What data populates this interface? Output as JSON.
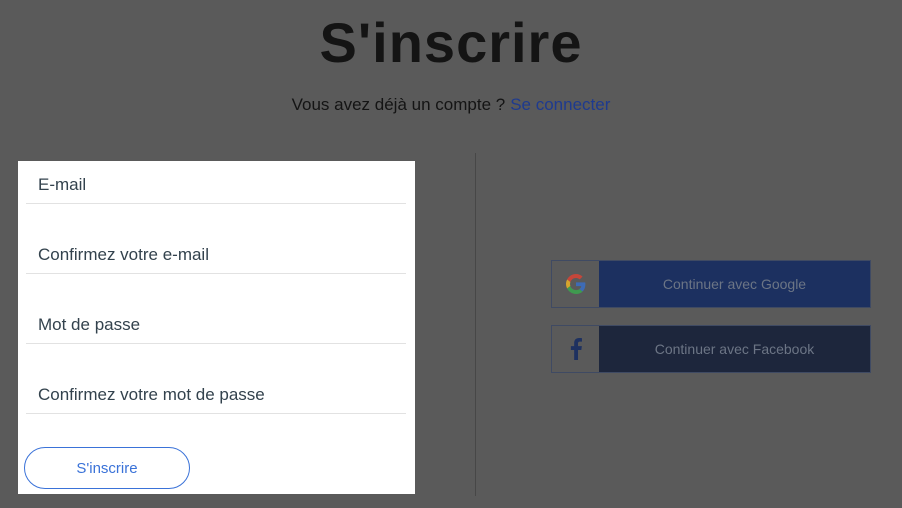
{
  "header": {
    "title": "S'inscrire",
    "question": "Vous avez déjà un compte ?",
    "login_link": "Se connecter"
  },
  "form": {
    "email_placeholder": "E-mail",
    "confirm_email_placeholder": "Confirmez votre e-mail",
    "password_placeholder": "Mot de passe",
    "confirm_password_placeholder": "Confirmez votre mot de passe",
    "submit_label": "S'inscrire"
  },
  "social": {
    "google_label": "Continuer avec Google",
    "facebook_label": "Continuer avec Facebook",
    "google_icon": "google-icon",
    "facebook_icon": "facebook-icon"
  },
  "colors": {
    "overlay": "#5a5a5a",
    "link": "#1e3a8f",
    "accent": "#3a72d8",
    "google_bg": "#1c3060",
    "facebook_bg": "#1d263c"
  }
}
